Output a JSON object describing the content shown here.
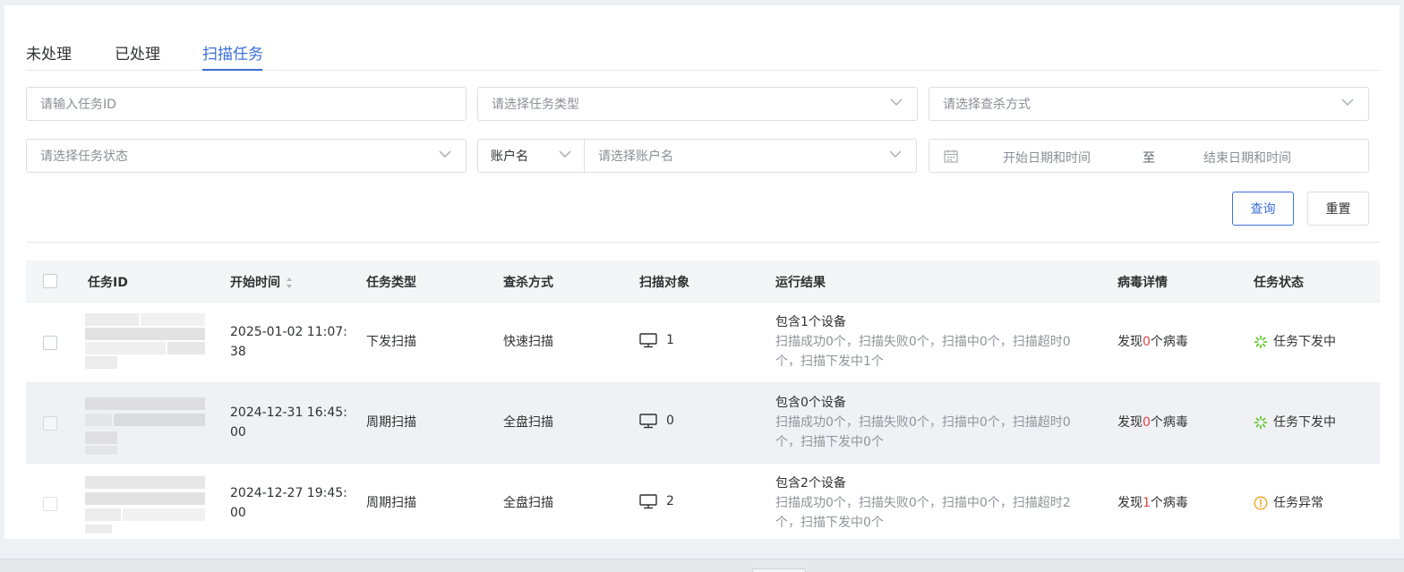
{
  "tabs": [
    {
      "label": "未处理"
    },
    {
      "label": "已处理"
    },
    {
      "label": "扫描任务"
    }
  ],
  "filters": {
    "task_id_placeholder": "请输入任务ID",
    "task_type_placeholder": "请选择任务类型",
    "scan_mode_placeholder": "请选择查杀方式",
    "task_status_placeholder": "请选择任务状态",
    "account_field_label": "账户名",
    "account_placeholder": "请选择账户名",
    "date_start_placeholder": "开始日期和时间",
    "date_separator": "至",
    "date_end_placeholder": "结束日期和时间"
  },
  "buttons": {
    "query": "查询",
    "reset": "重置"
  },
  "table": {
    "headers": {
      "task_id": "任务ID",
      "start_time": "开始时间",
      "task_type": "任务类型",
      "scan_mode": "查杀方式",
      "scan_target": "扫描对象",
      "run_result": "运行结果",
      "virus_detail": "病毒详情",
      "task_status": "任务状态"
    },
    "rows": [
      {
        "start_line1": "2025-01-02 11:07:",
        "start_line2": "38",
        "task_type": "下发扫描",
        "scan_mode": "快速扫描",
        "targets": "1",
        "result_title": "包含1个设备",
        "result_line1": "扫描成功0个，扫描失败0个，扫描中0个，扫描超时0",
        "result_line2": "个，扫描下发中1个",
        "virus_prefix": "发现",
        "virus_count": "0",
        "virus_suffix": "个病毒",
        "status": "任务下发中",
        "status_icon": "loading-spinner-icon",
        "status_color": "#52c41a"
      },
      {
        "start_line1": "2024-12-31 16:45:",
        "start_line2": "00",
        "task_type": "周期扫描",
        "scan_mode": "全盘扫描",
        "targets": "0",
        "result_title": "包含0个设备",
        "result_line1": "扫描成功0个，扫描失败0个，扫描中0个，扫描超时0",
        "result_line2": "个，扫描下发中0个",
        "virus_prefix": "发现",
        "virus_count": "0",
        "virus_suffix": "个病毒",
        "status": "任务下发中",
        "status_icon": "loading-spinner-icon",
        "status_color": "#52c41a"
      },
      {
        "start_line1": "2024-12-27 19:45:",
        "start_line2": "00",
        "task_type": "周期扫描",
        "scan_mode": "全盘扫描",
        "targets": "2",
        "result_title": "包含2个设备",
        "result_line1": "扫描成功0个，扫描失败0个，扫描中0个，扫描超时2",
        "result_line2": "个，扫描下发中0个",
        "virus_prefix": "发现",
        "virus_count": "1",
        "virus_suffix": "个病毒",
        "status": "任务异常",
        "status_icon": "warning-circle-icon",
        "status_color": "#f0a020"
      }
    ]
  },
  "colors": {
    "accent": "#3a6fd8",
    "virus_count": "#e04545",
    "muted_text": "#909399"
  },
  "icons": {
    "dropdown": "chevron-down-icon",
    "calendar": "calendar-icon",
    "sort": "sort-caret-icon",
    "monitor": "monitor-icon"
  }
}
